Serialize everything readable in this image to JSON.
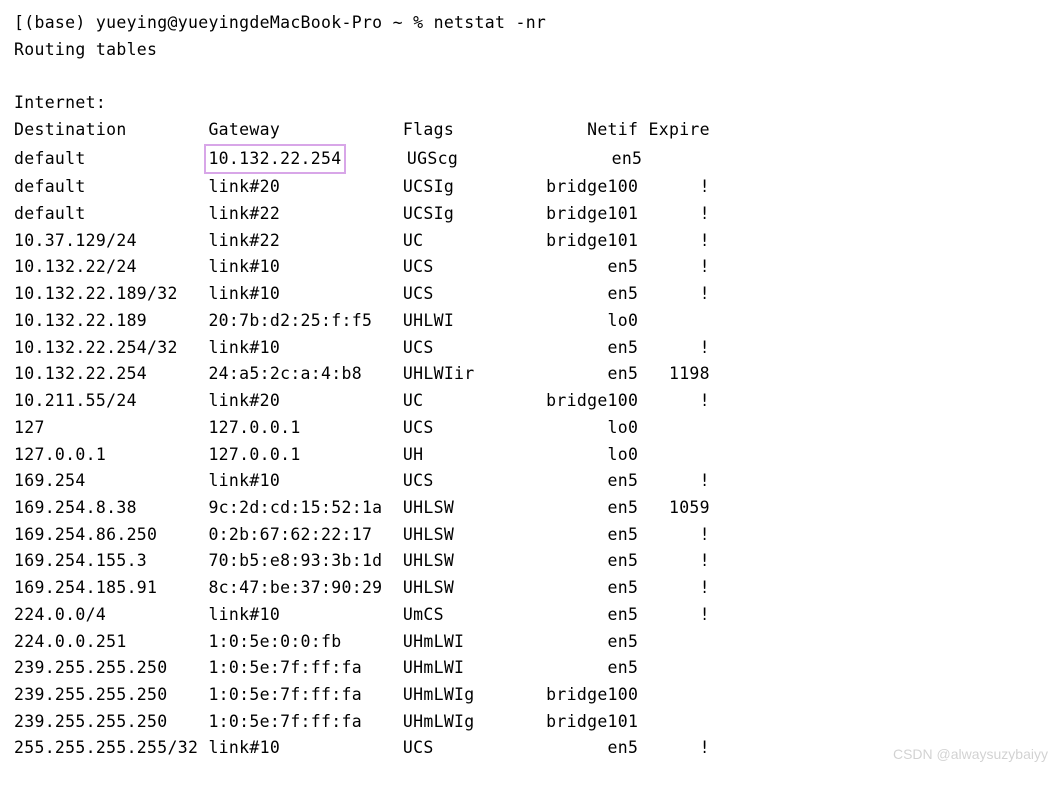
{
  "prompt": "[(base) yueying@yueyingdeMacBook-Pro ~ % netstat -nr",
  "title_line": "Routing tables",
  "section_label": "Internet:",
  "headers": {
    "dest": "Destination",
    "gw": "Gateway",
    "flags": "Flags",
    "netif": "Netif",
    "expire": "Expire"
  },
  "highlight_value": "10.132.22.254",
  "rows": [
    {
      "dest": "default",
      "gw": "10.132.22.254",
      "flags": "UGScg",
      "netif": "en5",
      "expire": "",
      "hl": true
    },
    {
      "dest": "default",
      "gw": "link#20",
      "flags": "UCSIg",
      "netif": "bridge100",
      "expire": "!"
    },
    {
      "dest": "default",
      "gw": "link#22",
      "flags": "UCSIg",
      "netif": "bridge101",
      "expire": "!"
    },
    {
      "dest": "10.37.129/24",
      "gw": "link#22",
      "flags": "UC",
      "netif": "bridge101",
      "expire": "!"
    },
    {
      "dest": "10.132.22/24",
      "gw": "link#10",
      "flags": "UCS",
      "netif": "en5",
      "expire": "!"
    },
    {
      "dest": "10.132.22.189/32",
      "gw": "link#10",
      "flags": "UCS",
      "netif": "en5",
      "expire": "!"
    },
    {
      "dest": "10.132.22.189",
      "gw": "20:7b:d2:25:f:f5",
      "flags": "UHLWI",
      "netif": "lo0",
      "expire": ""
    },
    {
      "dest": "10.132.22.254/32",
      "gw": "link#10",
      "flags": "UCS",
      "netif": "en5",
      "expire": "!"
    },
    {
      "dest": "10.132.22.254",
      "gw": "24:a5:2c:a:4:b8",
      "flags": "UHLWIir",
      "netif": "en5",
      "expire": "1198"
    },
    {
      "dest": "10.211.55/24",
      "gw": "link#20",
      "flags": "UC",
      "netif": "bridge100",
      "expire": "!"
    },
    {
      "dest": "127",
      "gw": "127.0.0.1",
      "flags": "UCS",
      "netif": "lo0",
      "expire": ""
    },
    {
      "dest": "127.0.0.1",
      "gw": "127.0.0.1",
      "flags": "UH",
      "netif": "lo0",
      "expire": ""
    },
    {
      "dest": "169.254",
      "gw": "link#10",
      "flags": "UCS",
      "netif": "en5",
      "expire": "!"
    },
    {
      "dest": "169.254.8.38",
      "gw": "9c:2d:cd:15:52:1a",
      "flags": "UHLSW",
      "netif": "en5",
      "expire": "1059"
    },
    {
      "dest": "169.254.86.250",
      "gw": "0:2b:67:62:22:17",
      "flags": "UHLSW",
      "netif": "en5",
      "expire": "!"
    },
    {
      "dest": "169.254.155.3",
      "gw": "70:b5:e8:93:3b:1d",
      "flags": "UHLSW",
      "netif": "en5",
      "expire": "!"
    },
    {
      "dest": "169.254.185.91",
      "gw": "8c:47:be:37:90:29",
      "flags": "UHLSW",
      "netif": "en5",
      "expire": "!"
    },
    {
      "dest": "224.0.0/4",
      "gw": "link#10",
      "flags": "UmCS",
      "netif": "en5",
      "expire": "!"
    },
    {
      "dest": "224.0.0.251",
      "gw": "1:0:5e:0:0:fb",
      "flags": "UHmLWI",
      "netif": "en5",
      "expire": ""
    },
    {
      "dest": "239.255.255.250",
      "gw": "1:0:5e:7f:ff:fa",
      "flags": "UHmLWI",
      "netif": "en5",
      "expire": ""
    },
    {
      "dest": "239.255.255.250",
      "gw": "1:0:5e:7f:ff:fa",
      "flags": "UHmLWIg",
      "netif": "bridge100",
      "expire": ""
    },
    {
      "dest": "239.255.255.250",
      "gw": "1:0:5e:7f:ff:fa",
      "flags": "UHmLWIg",
      "netif": "bridge101",
      "expire": ""
    },
    {
      "dest": "255.255.255.255/32",
      "gw": "link#10",
      "flags": "UCS",
      "netif": "en5",
      "expire": "!"
    }
  ],
  "watermark": "CSDN @alwaysuzybaiyy"
}
